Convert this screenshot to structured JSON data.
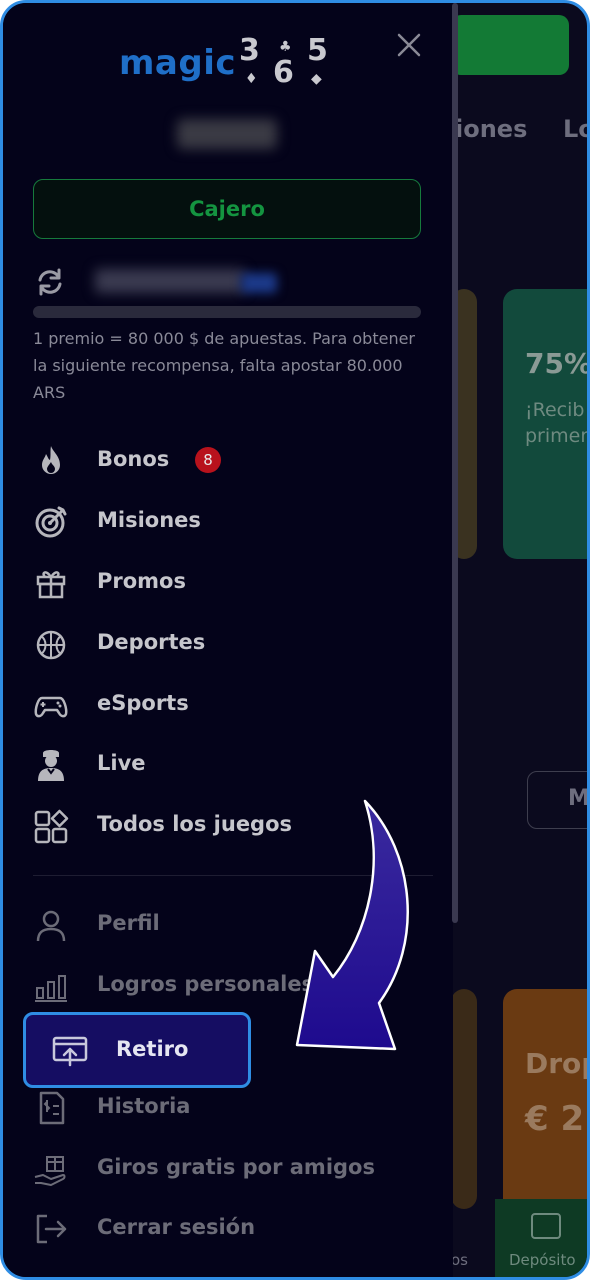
{
  "background": {
    "tabs": [
      "iones",
      "Lo"
    ],
    "promo_card_green": {
      "title": "75%",
      "text_line1": "¡Recib",
      "text_line2": "primer"
    },
    "outline_button": "M",
    "promo_card_orange": {
      "title": "Drop",
      "amount": "€ 2"
    },
    "bottom_nav": {
      "deposit_label": "Depósito",
      "left_label": "os"
    }
  },
  "drawer": {
    "logo": {
      "word": "magic",
      "digits": [
        "3",
        "6",
        "5"
      ]
    },
    "cashier_label": "Cajero",
    "reward_text": "1 premio = 80 000 $ de apuestas. Para obtener la siguiente recompensa, falta apostar 80.000 ARS",
    "progress_value": 0,
    "menu": [
      {
        "label": "Bonos",
        "icon": "fire-icon",
        "badge": "8"
      },
      {
        "label": "Misiones",
        "icon": "target-icon"
      },
      {
        "label": "Promos",
        "icon": "gift-icon"
      },
      {
        "label": "Deportes",
        "icon": "basketball-icon"
      },
      {
        "label": "eSports",
        "icon": "gamepad-icon"
      },
      {
        "label": "Live",
        "icon": "dealer-icon"
      },
      {
        "label": "Todos los juegos",
        "icon": "grid-icon"
      }
    ],
    "account_menu": [
      {
        "label": "Perfil",
        "icon": "user-icon"
      },
      {
        "label": "Logros personales",
        "icon": "bar-chart-icon"
      },
      {
        "label": "Retiro",
        "icon": "withdraw-icon"
      },
      {
        "label": "Historia",
        "icon": "receipt-icon"
      },
      {
        "label": "Giros gratis por amigos",
        "icon": "gift-hand-icon"
      },
      {
        "label": "Cerrar sesión",
        "icon": "logout-icon"
      }
    ]
  },
  "colors": {
    "accent": "#2f8de4",
    "cashier_green": "#149440",
    "badge_red": "#b8121c",
    "highlight": "#150d62"
  }
}
